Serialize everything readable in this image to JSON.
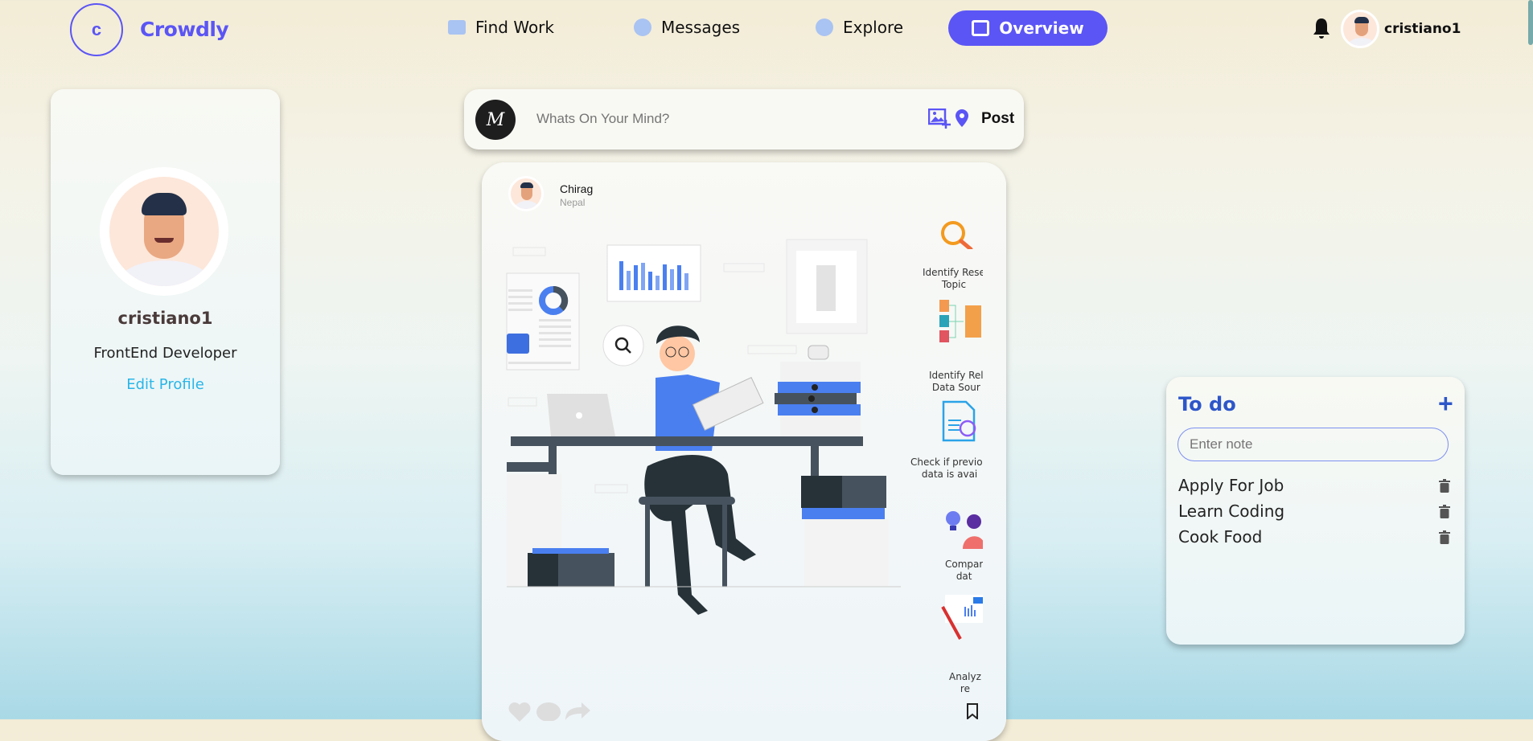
{
  "brand": {
    "logo_letter": "c",
    "name": "Crowdly",
    "color": "#5b55f5"
  },
  "nav": {
    "items": [
      {
        "label": "Find Work",
        "icon": "briefcase-icon"
      },
      {
        "label": "Messages",
        "icon": "chat-bubble-icon"
      },
      {
        "label": "Explore",
        "icon": "compass-icon"
      },
      {
        "label": "Overview",
        "icon": "gallery-icon",
        "active": true
      }
    ]
  },
  "header": {
    "username": "cristiano1",
    "bell_icon": "bell-icon"
  },
  "profile": {
    "name": "cristiano1",
    "role": "FrontEnd Developer",
    "edit_label": "Edit Profile",
    "link_color": "#29b6e8"
  },
  "composer": {
    "avatar_letter": "M",
    "placeholder": "Whats On Your Mind?",
    "post_label": "Post",
    "icons": [
      "add-image-icon",
      "location-pin-icon"
    ]
  },
  "post": {
    "author": "Chirag",
    "location": "Nepal",
    "illustration_labels": [
      {
        "line1": "Identify Rese",
        "line2": "Topic"
      },
      {
        "line1": "Identify Rel",
        "line2": "Data Sour"
      },
      {
        "line1": "Check if previou",
        "line2": "data is avai"
      },
      {
        "line1": "Compar",
        "line2": "dat"
      },
      {
        "line1": "Analyz",
        "line2": "re"
      }
    ],
    "actions": [
      "heart-icon",
      "comment-icon",
      "share-icon",
      "bookmark-icon"
    ]
  },
  "todo": {
    "title": "To do",
    "input_placeholder": "Enter note",
    "items": [
      "Apply For Job",
      "Learn Coding",
      "Cook Food"
    ],
    "accent": "#2d56c9"
  }
}
